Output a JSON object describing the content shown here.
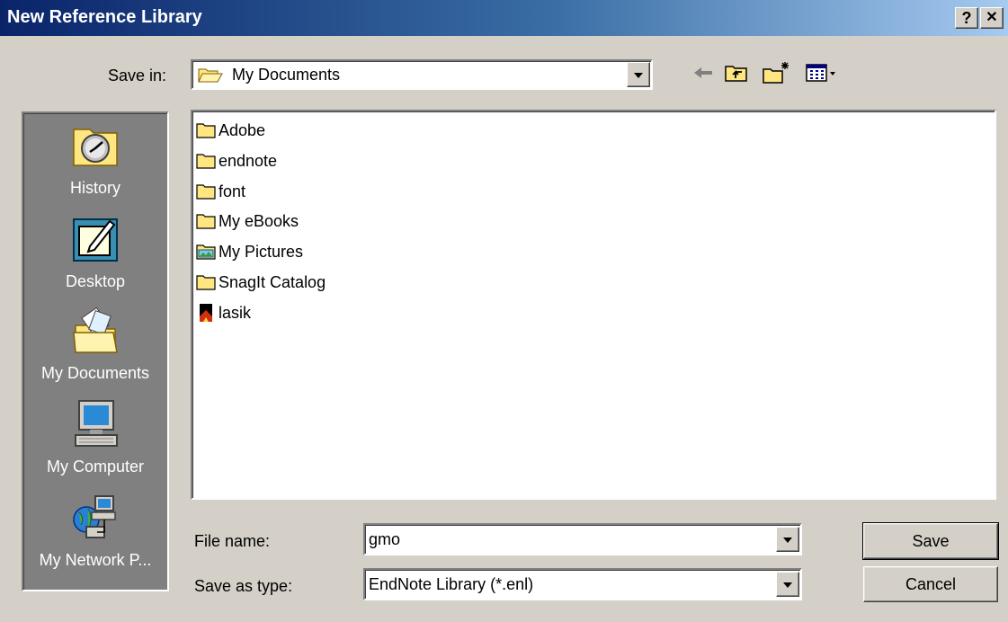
{
  "window": {
    "title": "New Reference Library",
    "help_label": "?",
    "close_label": "✕"
  },
  "save_in": {
    "label": "Save in:",
    "value": "My Documents"
  },
  "toolbar": {
    "back_icon": "back-arrow-icon",
    "up_icon": "up-folder-icon",
    "new_folder_icon": "new-folder-icon",
    "view_menu_icon": "view-menu-icon"
  },
  "places": [
    {
      "label": "History",
      "icon": "history-icon"
    },
    {
      "label": "Desktop",
      "icon": "desktop-icon"
    },
    {
      "label": "My Documents",
      "icon": "my-documents-icon"
    },
    {
      "label": "My Computer",
      "icon": "my-computer-icon"
    },
    {
      "label": "My Network P...",
      "icon": "my-network-places-icon"
    }
  ],
  "files": [
    {
      "name": "Adobe",
      "icon": "folder-icon"
    },
    {
      "name": "endnote",
      "icon": "folder-icon"
    },
    {
      "name": "font",
      "icon": "folder-icon"
    },
    {
      "name": "My eBooks",
      "icon": "folder-icon"
    },
    {
      "name": "My Pictures",
      "icon": "pictures-folder-icon"
    },
    {
      "name": "SnagIt Catalog",
      "icon": "folder-icon"
    },
    {
      "name": "lasik",
      "icon": "endnote-library-icon"
    }
  ],
  "file_name": {
    "label": "File name:",
    "value": "gmo"
  },
  "save_as_type": {
    "label": "Save as type:",
    "value": "EndNote Library (*.enl)"
  },
  "buttons": {
    "save": "Save",
    "cancel": "Cancel"
  },
  "colors": {
    "title_gradient_start": "#0a246a",
    "title_gradient_end": "#a6caf0",
    "dialog_face": "#d4d0c8",
    "places_bar": "#808080",
    "folder_yellow": "#ffe680"
  }
}
